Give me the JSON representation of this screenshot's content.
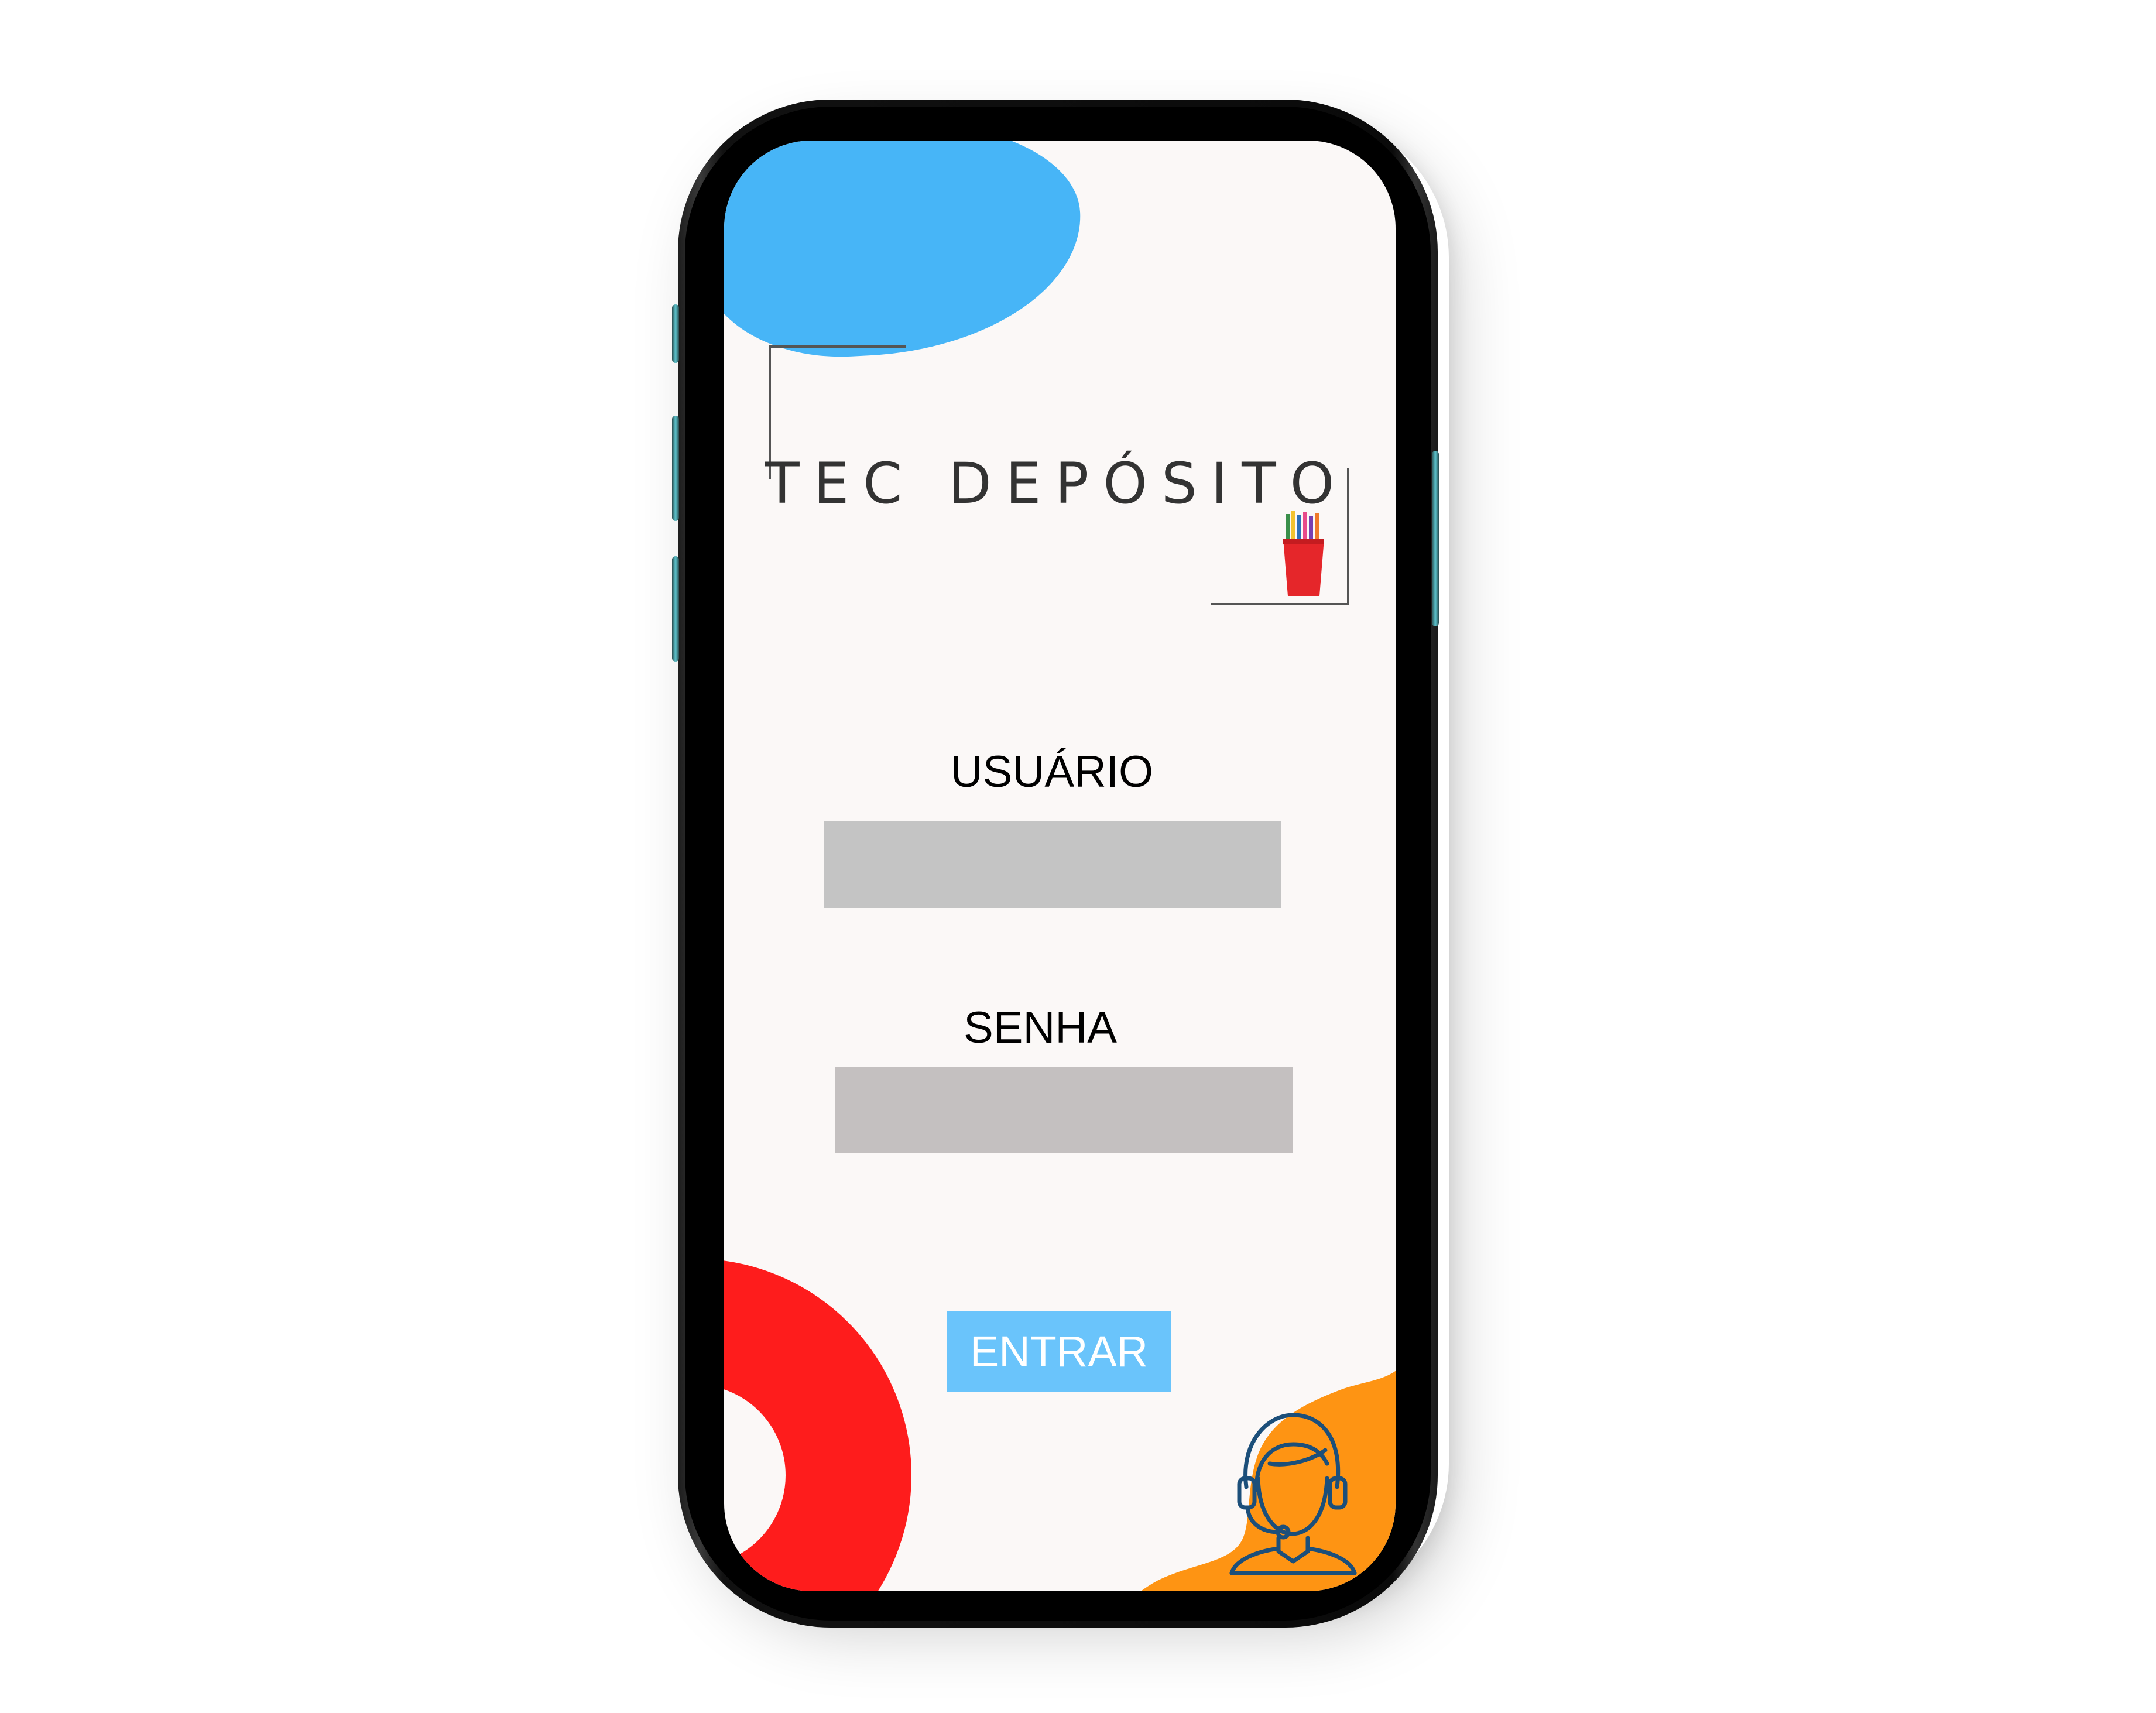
{
  "app": {
    "logo_text": "TEC DEPÓSITO"
  },
  "login_form": {
    "user_label": "USUÁRIO",
    "user_value": "",
    "password_label": "SENHA",
    "password_value": "",
    "submit_label": "ENTRAR"
  },
  "icons": {
    "logo": "pencil-cup-icon",
    "support": "headset-agent-icon"
  },
  "colors": {
    "screen_background": "#fbf8f7",
    "blue_blob": "#47b5f7",
    "red_ring": "#fe1c1c",
    "orange_blob": "#fe9413",
    "button_background": "#6ac4fb",
    "input_background": "#c4c4c4",
    "support_icon_stroke": "#1c4f7a"
  }
}
